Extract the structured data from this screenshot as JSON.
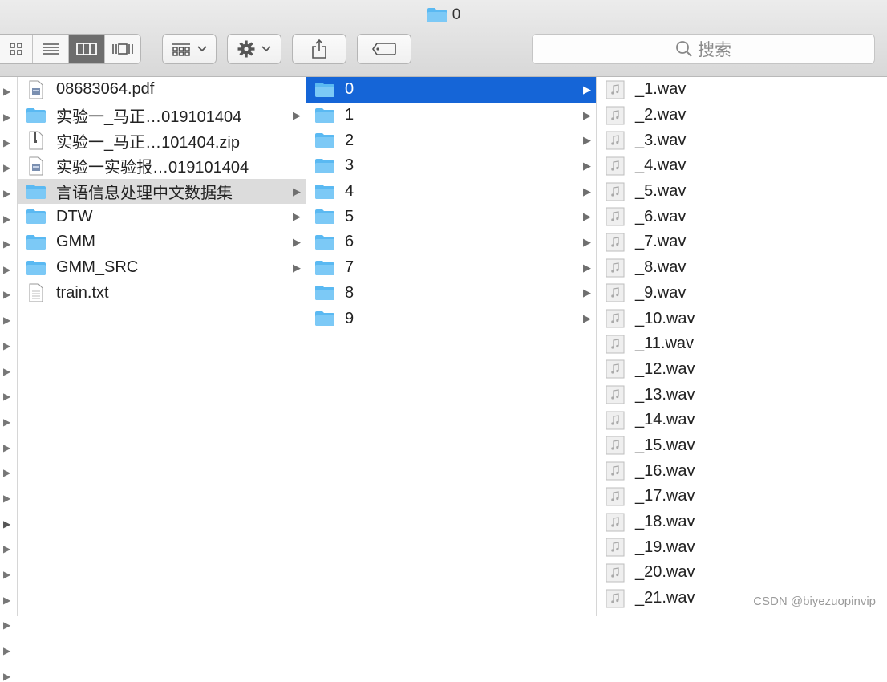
{
  "window": {
    "title": "0"
  },
  "toolbar": {
    "search_placeholder": "搜索"
  },
  "sidebar_arrows": [
    13,
    45,
    77,
    108,
    140,
    172,
    203,
    235,
    266,
    298,
    330,
    362,
    393,
    425,
    457,
    488,
    520,
    552,
    583,
    615,
    647,
    678,
    710,
    742
  ],
  "column1": [
    {
      "label": "08683064.pdf",
      "icon": "pdf-icon",
      "chevron": false,
      "selected": ""
    },
    {
      "label": "实验一_马正…019101404",
      "icon": "folder-icon",
      "chevron": true,
      "selected": ""
    },
    {
      "label": "实验一_马正…101404.zip",
      "icon": "zip-icon",
      "chevron": false,
      "selected": ""
    },
    {
      "label": "实验一实验报…019101404",
      "icon": "pdf-icon",
      "chevron": false,
      "selected": ""
    },
    {
      "label": "言语信息处理中文数据集",
      "icon": "folder-icon",
      "chevron": true,
      "selected": "grey"
    },
    {
      "label": "DTW",
      "icon": "folder-icon",
      "chevron": true,
      "selected": ""
    },
    {
      "label": "GMM",
      "icon": "folder-icon",
      "chevron": true,
      "selected": ""
    },
    {
      "label": "GMM_SRC",
      "icon": "folder-icon",
      "chevron": true,
      "selected": ""
    },
    {
      "label": "train.txt",
      "icon": "text-file-icon",
      "chevron": false,
      "selected": ""
    }
  ],
  "column2": [
    {
      "label": "0",
      "selected": "blue"
    },
    {
      "label": "1"
    },
    {
      "label": "2"
    },
    {
      "label": "3"
    },
    {
      "label": "4"
    },
    {
      "label": "5"
    },
    {
      "label": "6"
    },
    {
      "label": "7"
    },
    {
      "label": "8"
    },
    {
      "label": "9"
    }
  ],
  "column3": [
    "_1.wav",
    "_2.wav",
    "_3.wav",
    "_4.wav",
    "_5.wav",
    "_6.wav",
    "_7.wav",
    "_8.wav",
    "_9.wav",
    "_10.wav",
    "_11.wav",
    "_12.wav",
    "_13.wav",
    "_14.wav",
    "_15.wav",
    "_16.wav",
    "_17.wav",
    "_18.wav",
    "_19.wav",
    "_20.wav",
    "_21.wav"
  ],
  "watermark": "CSDN @biyezuopinvip",
  "colors": {
    "selection_blue": "#1565d7",
    "selection_grey": "#dcdcdc",
    "folder": "#5ab9f2"
  }
}
